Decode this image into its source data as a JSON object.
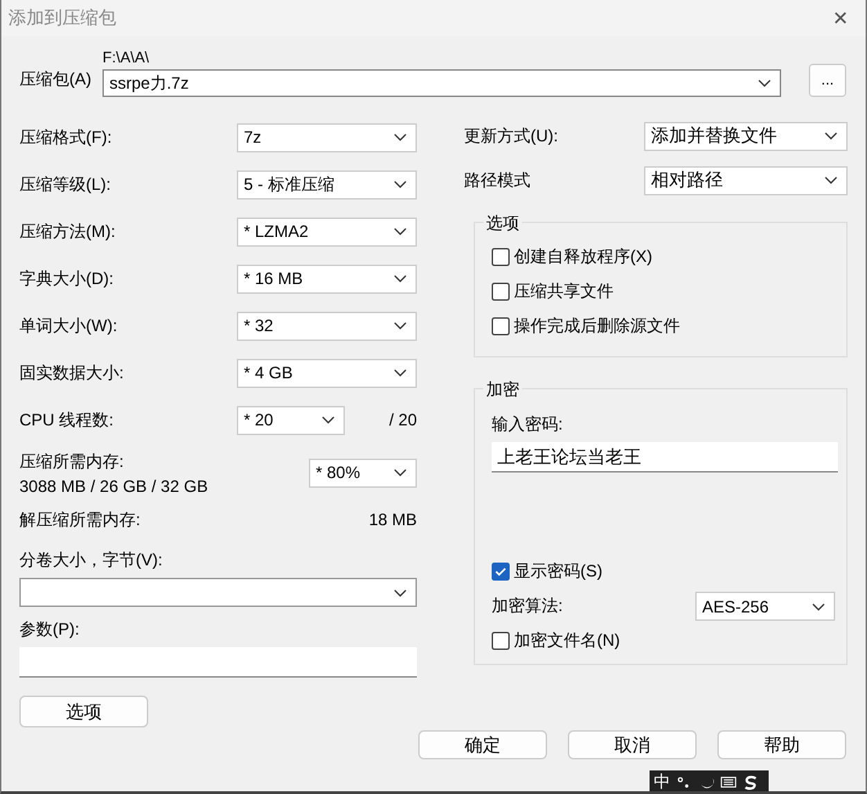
{
  "window": {
    "title": "添加到压缩包",
    "close": "✕"
  },
  "archive": {
    "label": "压缩包(A)",
    "path": "F:\\A\\A\\",
    "value": "ssrpe力.7z",
    "browse": "..."
  },
  "left_fields": [
    {
      "kind": "combo",
      "label": "压缩格式(F):",
      "value": "7z"
    },
    {
      "kind": "combo",
      "label": "压缩等级(L):",
      "value": "5 - 标准压缩"
    },
    {
      "kind": "combo",
      "label": "压缩方法(M):",
      "value": "* LZMA2"
    },
    {
      "kind": "combo",
      "label": "字典大小(D):",
      "value": "* 16 MB"
    },
    {
      "kind": "combo",
      "label": "单词大小(W):",
      "value": "* 32"
    },
    {
      "kind": "combo",
      "label": "固实数据大小:",
      "value": "* 4 GB"
    },
    {
      "kind": "cpu",
      "label": "CPU 线程数:",
      "value": "* 20",
      "suffix": "/ 20"
    },
    {
      "kind": "memory",
      "label": "压缩所需内存:",
      "detail": "3088 MB / 26 GB / 32 GB",
      "value": "* 80%"
    },
    {
      "kind": "info",
      "label": "解压缩所需内存:",
      "value": "18 MB"
    }
  ],
  "volume": {
    "label": "分卷大小，字节(V):"
  },
  "parameters": {
    "label": "参数(P):"
  },
  "options_button": "选项",
  "right_fields": [
    {
      "label": "更新方式(U):",
      "value": "添加并替换文件"
    },
    {
      "label": "路径模式",
      "value": "相对路径"
    }
  ],
  "options_group": {
    "title": "选项",
    "checkboxes": [
      {
        "label": "创建自释放程序(X)",
        "checked": false
      },
      {
        "label": "压缩共享文件",
        "checked": false
      },
      {
        "label": "操作完成后删除源文件",
        "checked": false
      }
    ]
  },
  "encryption": {
    "title": "加密",
    "password_label": "输入密码:",
    "password": "上老王论坛当老王",
    "show_password": {
      "label": "显示密码(S)",
      "checked": true
    },
    "method_label": "加密算法:",
    "method": "AES-256",
    "encrypt_names": {
      "label": "加密文件名(N)",
      "checked": false
    }
  },
  "buttons": [
    "确定",
    "取消",
    "帮助"
  ],
  "ime_bar": {
    "mode": "中"
  }
}
